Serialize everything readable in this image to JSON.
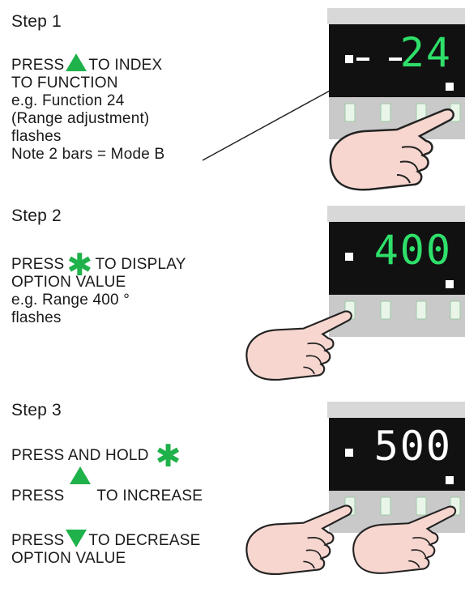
{
  "step1": {
    "title": "Step 1",
    "press": "PRESS",
    "to_index": "TO INDEX",
    "line2": "TO FUNCTION",
    "line3": "e.g. Function 24",
    "line4": "(Range adjustment)",
    "line5": "flashes",
    "line6": "Note 2 bars = Mode B",
    "display": "24"
  },
  "step2": {
    "title": "Step 2",
    "press": "PRESS",
    "to_display": "TO DISPLAY",
    "line2": "OPTION VALUE",
    "line3": "e.g. Range 400 °",
    "line4": "flashes",
    "display": "400"
  },
  "step3": {
    "title": "Step 3",
    "press_hold": "PRESS AND HOLD",
    "press_a": "PRESS",
    "to_increase": "TO INCREASE",
    "press_b": "PRESS",
    "to_decrease": "TO DECREASE",
    "line_last": "OPTION VALUE",
    "display": "500"
  },
  "colors": {
    "green": "#1fb14a",
    "display_green": "#2ee06a",
    "panel_dark": "#111111",
    "panel_grey": "#c9c9c9",
    "hand_fill": "#f7d6cf"
  },
  "icons": [
    "up-triangle-icon",
    "down-triangle-icon",
    "asterisk-icon",
    "pointing-hand"
  ]
}
